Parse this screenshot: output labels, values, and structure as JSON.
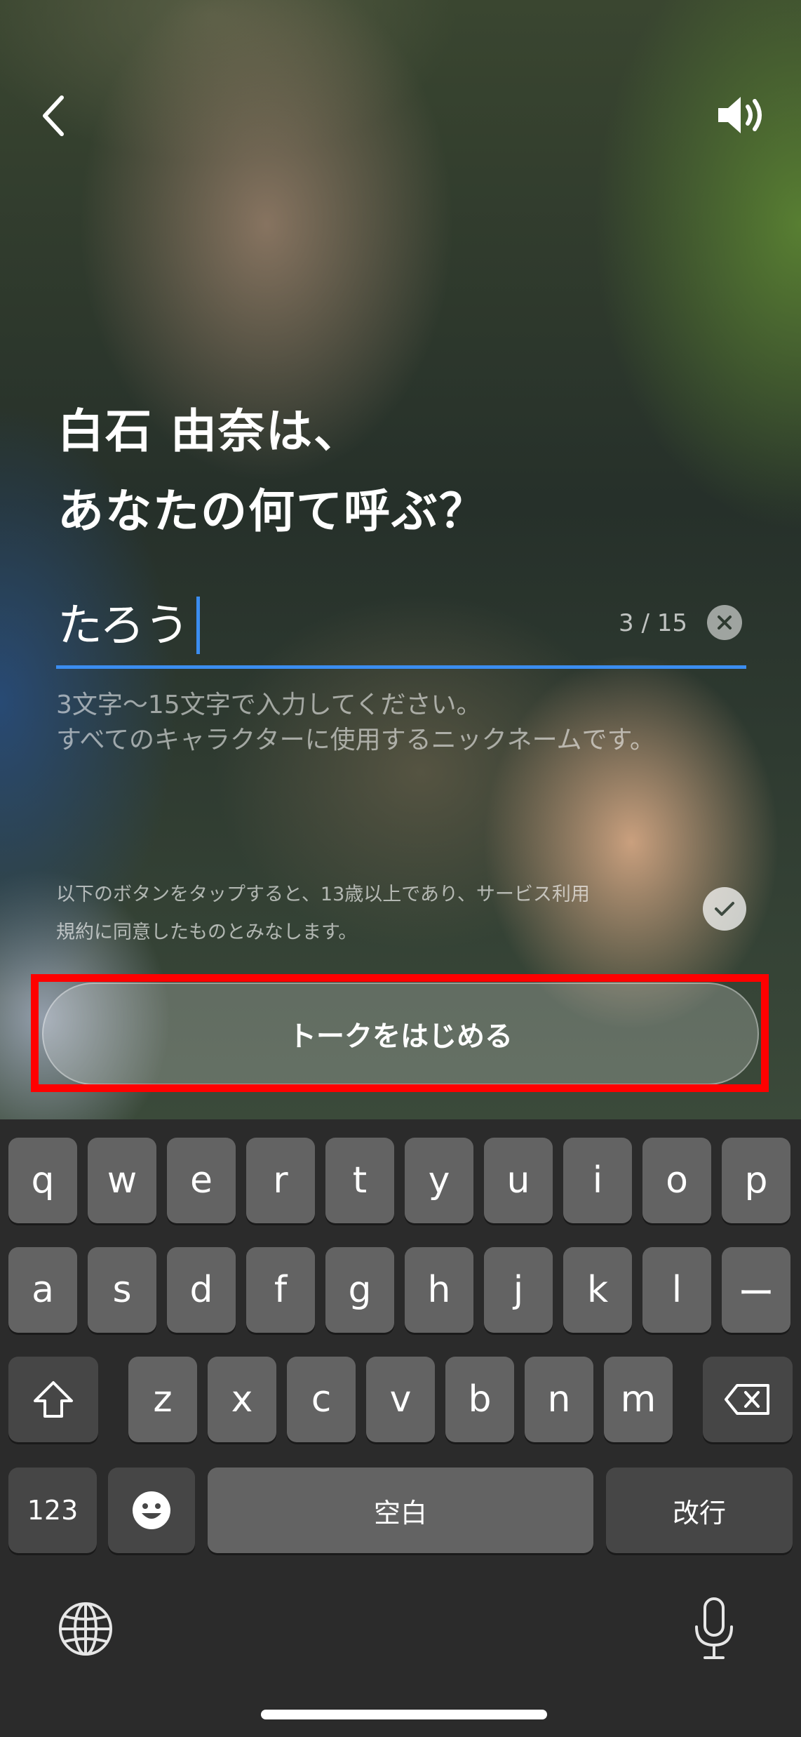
{
  "header": {
    "back_icon": "chevron-left-icon",
    "sound_icon": "speaker-volume-icon"
  },
  "headline": {
    "line1": "白石 由奈は、",
    "line2": "あなたの何て呼ぶ？"
  },
  "nickname_input": {
    "value": "たろう",
    "counter": "3 / 15",
    "clear_icon": "clear-x-icon",
    "accent_color": "#3b8df0"
  },
  "helper_text": {
    "line1": "3文字〜15文字で入力してください。",
    "line2": "すべてのキャラクターに使用するニックネームです。"
  },
  "terms": {
    "line1": "以下のボタンをタップすると、13歳以上であり、サービス利用",
    "line2": "規約に同意したものとみなします。",
    "check_icon": "checkmark-icon"
  },
  "start_button": {
    "label": "トークをはじめる",
    "highlight_color": "#ff0000"
  },
  "keyboard": {
    "row1": [
      "q",
      "w",
      "e",
      "r",
      "t",
      "y",
      "u",
      "i",
      "o",
      "p"
    ],
    "row2": [
      "a",
      "s",
      "d",
      "f",
      "g",
      "h",
      "j",
      "k",
      "l",
      "ー"
    ],
    "row3": [
      "z",
      "x",
      "c",
      "v",
      "b",
      "n",
      "m"
    ],
    "numbers_label": "123",
    "space_label": "空白",
    "return_label": "改行",
    "shift_icon": "shift-icon",
    "delete_icon": "backspace-icon",
    "emoji_icon": "emoji-icon",
    "globe_icon": "globe-icon",
    "mic_icon": "microphone-icon"
  }
}
